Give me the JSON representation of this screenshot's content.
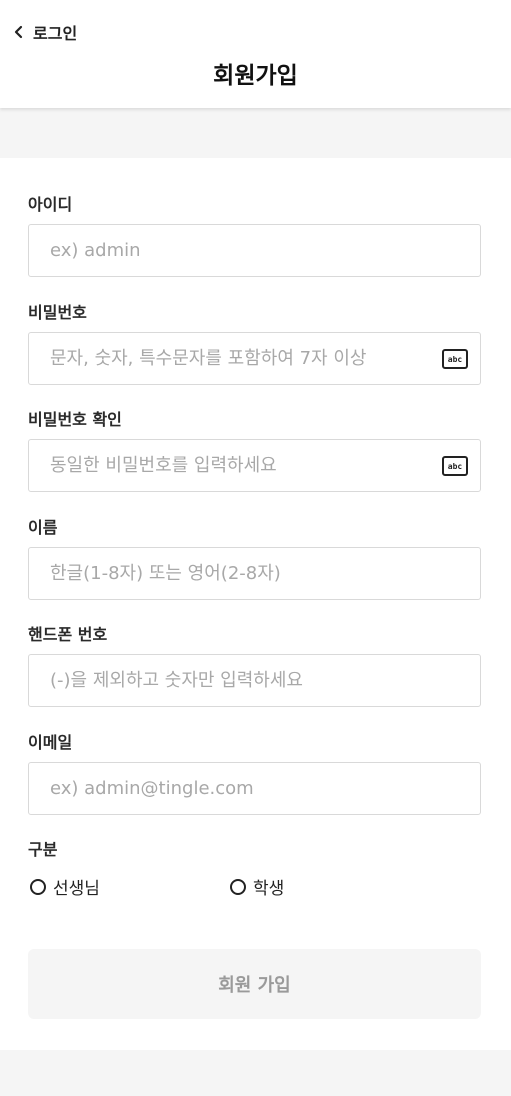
{
  "header": {
    "back_label": "로그인",
    "title": "회원가입"
  },
  "form": {
    "fields": [
      {
        "label": "아이디",
        "placeholder": "ex) admin",
        "value": ""
      },
      {
        "label": "비밀번호",
        "placeholder": "문자, 숫자, 특수문자를 포함하여 7자 이상",
        "value": "",
        "icon": "keyboard-abc-icon",
        "icon_text": "abc"
      },
      {
        "label": "비밀번호 확인",
        "placeholder": "동일한 비밀번호를 입력하세요",
        "value": "",
        "icon": "keyboard-abc-icon",
        "icon_text": "abc"
      },
      {
        "label": "이름",
        "placeholder": "한글(1-8자) 또는 영어(2-8자)",
        "value": ""
      },
      {
        "label": "핸드폰 번호",
        "placeholder": "(-)을 제외하고 숫자만 입력하세요",
        "value": ""
      },
      {
        "label": "이메일",
        "placeholder": "ex) admin@tingle.com",
        "value": ""
      }
    ],
    "role": {
      "label": "구분",
      "options": [
        "선생님",
        "학생"
      ]
    },
    "submit_label": "회원 가입"
  },
  "colors": {
    "page_background": "#f5f5f5",
    "card_background": "#ffffff",
    "input_border": "#d9d9d9",
    "placeholder": "#a8a8a8",
    "button_background": "#f5f5f5",
    "button_text": "#9a9a9a"
  }
}
